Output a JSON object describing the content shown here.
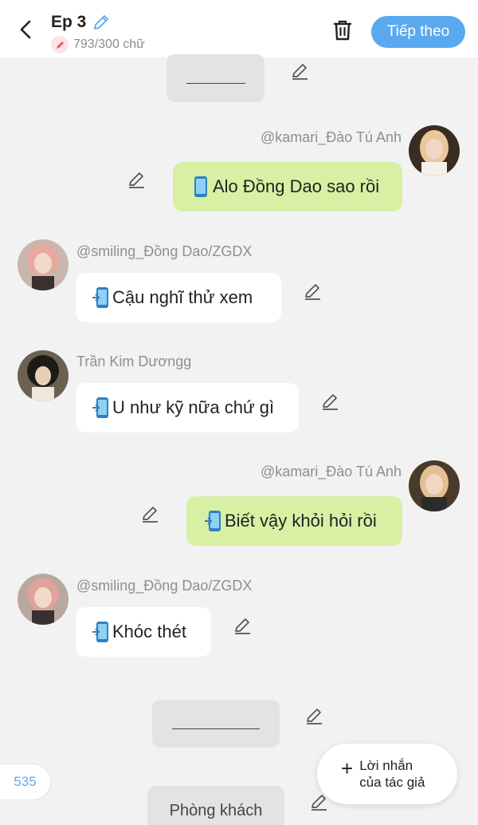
{
  "header": {
    "title": "Ep 3",
    "word_count": "793/300 chữ",
    "next_label": "Tiếp theo"
  },
  "messages": [
    {
      "side": "right",
      "author": "@kamari_Đào Tú Anh",
      "text": "Alo Đồng Dao sao rồi"
    },
    {
      "side": "left",
      "author": "@smiling_Đồng Dao/ZGDX",
      "text": "Cậu nghĩ thử xem"
    },
    {
      "side": "left",
      "author": "Trần Kim Dươngg",
      "text": "U như kỹ nữa chứ gì"
    },
    {
      "side": "right",
      "author": "@kamari_Đào Tú Anh",
      "text": "Biết vậy khỏi hỏi rồi"
    },
    {
      "side": "left",
      "author": "@smiling_Đồng Dao/ZGDX",
      "text": "Khóc thét"
    }
  ],
  "scene_bottom_label": "Phòng khách",
  "counter": "535",
  "author_note_label": "Lời nhắn\ncủa tác giả",
  "colors": {
    "accent": "#5aa9ee",
    "bubble_right": "#d8f0a4",
    "bubble_left": "#ffffff",
    "background": "#f2f2f2"
  },
  "icons": [
    "back-icon",
    "edit-pencil-icon",
    "trash-icon",
    "phone-icon",
    "plus-icon"
  ]
}
